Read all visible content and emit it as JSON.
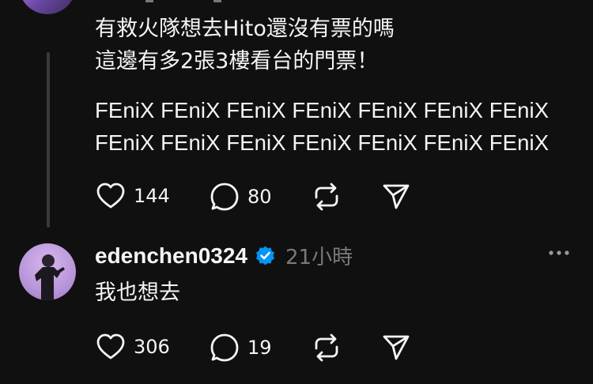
{
  "post1": {
    "line1": "有救火隊想去Hito還沒有票的嗎",
    "line2": "這邊有多2張3樓看台的門票！",
    "fenix_line1": "FEniX FEniX FEniX FEniX FEniX FEniX FEniX",
    "fenix_line2": "FEniX FEniX FEniX FEniX FEniX FEniX FEniX",
    "likes": "144",
    "comments": "80"
  },
  "reply": {
    "username": "edenchen0324",
    "time": "21小時",
    "text": "我也想去",
    "likes": "306",
    "comments": "19"
  },
  "icons": {
    "like": "heart-icon",
    "comment": "comment-bubble-icon",
    "repost": "repost-icon",
    "share": "send-icon",
    "verified": "verified-badge-icon",
    "more": "more-icon"
  },
  "colors": {
    "background": "#101010",
    "text": "#f3f5f7",
    "muted": "#7a7a7a",
    "verified": "#0095f6"
  }
}
